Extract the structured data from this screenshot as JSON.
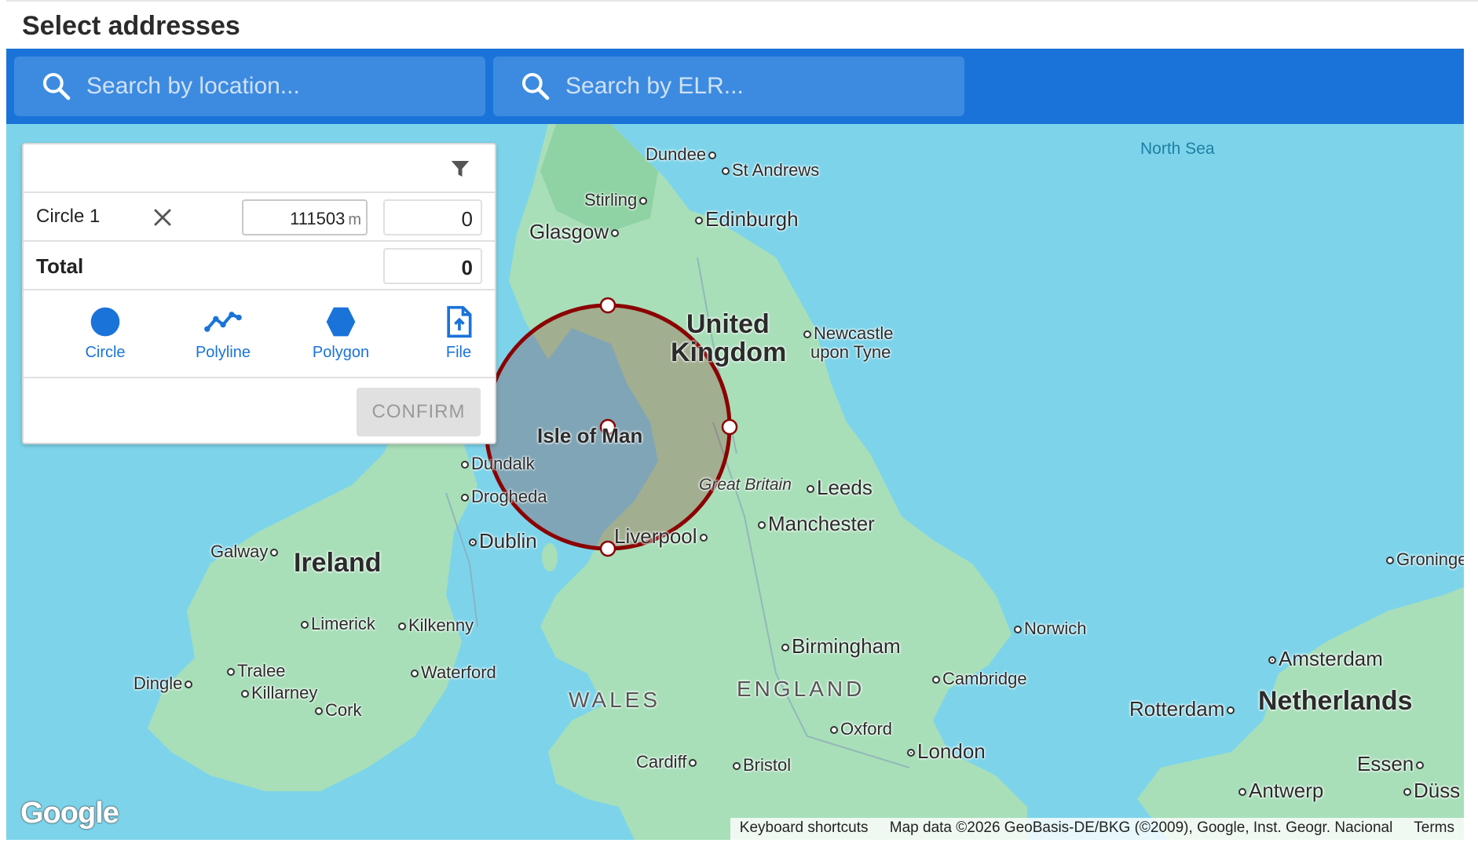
{
  "header": {
    "title": "Select addresses"
  },
  "search": {
    "location_placeholder": "Search by location...",
    "elr_placeholder": "Search by ELR..."
  },
  "panel": {
    "circle_row": {
      "name": "Circle 1",
      "radius_value": "111503",
      "radius_unit": "m",
      "count": "0"
    },
    "total_row": {
      "label": "Total",
      "count": "0"
    },
    "tools": [
      {
        "label": "Circle",
        "icon": "circle-icon"
      },
      {
        "label": "Polyline",
        "icon": "polyline-icon"
      },
      {
        "label": "Polygon",
        "icon": "polygon-icon"
      },
      {
        "label": "File",
        "icon": "file-upload-icon"
      }
    ],
    "confirm_label": "CONFIRM"
  },
  "map": {
    "labels": {
      "north_sea": "North Sea",
      "dundee": "Dundee",
      "st_andrews": "St Andrews",
      "stirling": "Stirling",
      "edinburgh": "Edinburgh",
      "glasgow": "Glasgow",
      "united_kingdom_1": "United",
      "united_kingdom_2": "Kingdom",
      "newcastle_1": "Newcastle",
      "newcastle_2": "upon Tyne",
      "isle_of_man": "Isle of Man",
      "dundalk": "Dundalk",
      "drogheda": "Drogheda",
      "dublin": "Dublin",
      "galway": "Galway",
      "ireland": "Ireland",
      "limerick": "Limerick",
      "kilkenny": "Kilkenny",
      "tralee": "Tralee",
      "dingle": "Dingle",
      "killarney": "Killarney",
      "waterford": "Waterford",
      "cork": "Cork",
      "great_britain": "Great Britain",
      "leeds": "Leeds",
      "liverpool": "Liverpool",
      "manchester": "Manchester",
      "birmingham": "Birmingham",
      "norwich": "Norwich",
      "cambridge": "Cambridge",
      "wales": "WALES",
      "england": "ENGLAND",
      "oxford": "Oxford",
      "london": "London",
      "cardiff": "Cardiff",
      "bristol": "Bristol",
      "groningen": "Groninge",
      "amsterdam": "Amsterdam",
      "rotterdam": "Rotterdam",
      "netherlands": "Netherlands",
      "essen": "Essen",
      "antwerp": "Antwerp",
      "dusseldorf": "Düss"
    },
    "attribution": {
      "shortcuts": "Keyboard shortcuts",
      "data": "Map data ©2026 GeoBasis-DE/BKG (©2009), Google, Inst. Geogr. Nacional",
      "terms": "Terms"
    },
    "logo": "Google",
    "colors": {
      "water": "#7dd4ea",
      "land": "#a8dfb9",
      "circle_stroke": "#8b0000",
      "accent": "#1a73d9"
    }
  }
}
